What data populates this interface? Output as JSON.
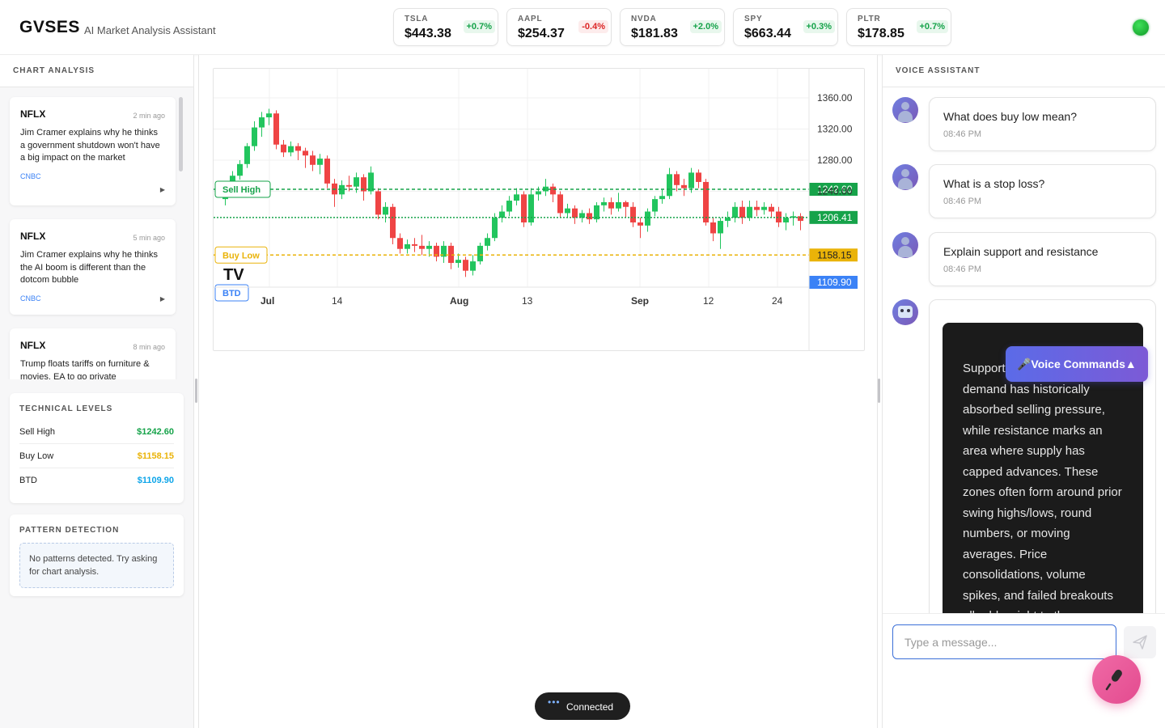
{
  "header": {
    "brand": "GVSES",
    "subtitle": "AI Market Analysis Assistant",
    "tickers": [
      {
        "symbol": "TSLA",
        "price": "$443.38",
        "change": "+0.7%",
        "direction": "up"
      },
      {
        "symbol": "AAPL",
        "price": "$254.37",
        "change": "-0.4%",
        "direction": "down"
      },
      {
        "symbol": "NVDA",
        "price": "$181.83",
        "change": "+2.0%",
        "direction": "up"
      },
      {
        "symbol": "SPY",
        "price": "$663.44",
        "change": "+0.3%",
        "direction": "up"
      },
      {
        "symbol": "PLTR",
        "price": "$178.85",
        "change": "+0.7%",
        "direction": "up"
      }
    ],
    "status_color": "#16a34a"
  },
  "left": {
    "title": "CHART ANALYSIS",
    "news": [
      {
        "symbol": "NFLX",
        "time": "2 min ago",
        "title": "Jim Cramer explains why he thinks a government shutdown won't have a big impact on the market",
        "source": "CNBC"
      },
      {
        "symbol": "NFLX",
        "time": "5 min ago",
        "title": "Jim Cramer explains why he thinks the AI boom is different than the dotcom bubble",
        "source": "CNBC"
      },
      {
        "symbol": "NFLX",
        "time": "8 min ago",
        "title": "Trump floats tariffs on furniture & movies. EA to go private",
        "source": ""
      }
    ],
    "technical_levels": {
      "title": "TECHNICAL LEVELS",
      "rows": [
        {
          "label": "Sell High",
          "value": "$1242.60",
          "color": "#16a34a"
        },
        {
          "label": "Buy Low",
          "value": "$1158.15",
          "color": "#eab308"
        },
        {
          "label": "BTD",
          "value": "$1109.90",
          "color": "#0ea5e9"
        }
      ]
    },
    "patterns": {
      "title": "PATTERN DETECTION",
      "empty_text": "No patterns detected. Try asking for chart analysis."
    }
  },
  "chart": {
    "price_labels": [
      "1360.00",
      "1320.00",
      "1280.00",
      "1240.00"
    ],
    "x_labels": [
      "Jul",
      "14",
      "Aug",
      "13",
      "Sep",
      "12",
      "24"
    ],
    "sell_high": {
      "label": "Sell High",
      "value": 1242.6,
      "tag": "1242.60",
      "color": "#16a34a"
    },
    "buy_low": {
      "label": "Buy Low",
      "value": 1158.15,
      "tag": "1158.15",
      "color": "#eab308"
    },
    "btd": {
      "label": "BTD",
      "value": 1109.9,
      "tag": "1109.90",
      "color": "#3b82f6"
    },
    "last_price": {
      "value": 1206.41,
      "tag": "1206.41",
      "color": "#16a34a"
    },
    "up_color": "#22c55e",
    "down_color": "#ef4444",
    "watermark": "TV"
  },
  "chart_data": {
    "type": "candlestick",
    "ylim": [
      1100,
      1380
    ],
    "candles": [
      [
        1230,
        1248,
        1252,
        1222
      ],
      [
        1248,
        1260,
        1266,
        1242
      ],
      [
        1260,
        1275,
        1280,
        1255
      ],
      [
        1275,
        1298,
        1302,
        1270
      ],
      [
        1298,
        1322,
        1330,
        1292
      ],
      [
        1322,
        1335,
        1342,
        1310
      ],
      [
        1335,
        1340,
        1346,
        1325
      ],
      [
        1340,
        1300,
        1344,
        1294
      ],
      [
        1300,
        1290,
        1306,
        1284
      ],
      [
        1290,
        1298,
        1304,
        1285
      ],
      [
        1298,
        1292,
        1302,
        1280
      ],
      [
        1292,
        1286,
        1296,
        1270
      ],
      [
        1286,
        1274,
        1292,
        1266
      ],
      [
        1274,
        1282,
        1288,
        1262
      ],
      [
        1282,
        1250,
        1286,
        1244
      ],
      [
        1250,
        1236,
        1256,
        1220
      ],
      [
        1236,
        1248,
        1254,
        1230
      ],
      [
        1248,
        1246,
        1260,
        1240
      ],
      [
        1246,
        1258,
        1264,
        1238
      ],
      [
        1258,
        1240,
        1262,
        1228
      ],
      [
        1240,
        1264,
        1272,
        1236
      ],
      [
        1240,
        1210,
        1244,
        1204
      ],
      [
        1210,
        1220,
        1226,
        1200
      ],
      [
        1220,
        1180,
        1224,
        1172
      ],
      [
        1180,
        1166,
        1186,
        1160
      ],
      [
        1166,
        1172,
        1178,
        1160
      ],
      [
        1172,
        1170,
        1180,
        1162
      ],
      [
        1170,
        1166,
        1184,
        1158
      ],
      [
        1166,
        1170,
        1176,
        1156
      ],
      [
        1170,
        1156,
        1174,
        1150
      ],
      [
        1156,
        1170,
        1176,
        1148
      ],
      [
        1170,
        1148,
        1174,
        1140
      ],
      [
        1148,
        1152,
        1160,
        1142
      ],
      [
        1152,
        1138,
        1156,
        1130
      ],
      [
        1138,
        1150,
        1158,
        1132
      ],
      [
        1150,
        1170,
        1174,
        1146
      ],
      [
        1170,
        1180,
        1186,
        1164
      ],
      [
        1180,
        1206,
        1212,
        1176
      ],
      [
        1206,
        1214,
        1222,
        1200
      ],
      [
        1214,
        1228,
        1234,
        1208
      ],
      [
        1228,
        1236,
        1244,
        1222
      ],
      [
        1236,
        1200,
        1240,
        1194
      ],
      [
        1200,
        1236,
        1244,
        1196
      ],
      [
        1236,
        1240,
        1246,
        1228
      ],
      [
        1240,
        1246,
        1256,
        1234
      ],
      [
        1246,
        1236,
        1250,
        1226
      ],
      [
        1236,
        1212,
        1240,
        1206
      ],
      [
        1212,
        1218,
        1224,
        1206
      ],
      [
        1218,
        1206,
        1222,
        1198
      ],
      [
        1206,
        1212,
        1216,
        1200
      ],
      [
        1212,
        1204,
        1218,
        1198
      ],
      [
        1204,
        1222,
        1226,
        1200
      ],
      [
        1222,
        1226,
        1232,
        1214
      ],
      [
        1226,
        1218,
        1232,
        1210
      ],
      [
        1218,
        1226,
        1238,
        1214
      ],
      [
        1226,
        1220,
        1228,
        1206
      ],
      [
        1220,
        1200,
        1226,
        1194
      ],
      [
        1200,
        1196,
        1206,
        1180
      ],
      [
        1196,
        1214,
        1218,
        1188
      ],
      [
        1214,
        1230,
        1234,
        1208
      ],
      [
        1230,
        1234,
        1242,
        1224
      ],
      [
        1234,
        1262,
        1270,
        1230
      ],
      [
        1262,
        1248,
        1266,
        1240
      ],
      [
        1248,
        1244,
        1256,
        1234
      ],
      [
        1244,
        1264,
        1270,
        1238
      ],
      [
        1264,
        1252,
        1268,
        1244
      ],
      [
        1252,
        1200,
        1256,
        1196
      ],
      [
        1200,
        1186,
        1206,
        1176
      ],
      [
        1186,
        1202,
        1206,
        1166
      ],
      [
        1202,
        1206,
        1214,
        1194
      ],
      [
        1206,
        1220,
        1226,
        1200
      ],
      [
        1220,
        1206,
        1228,
        1198
      ],
      [
        1206,
        1220,
        1228,
        1202
      ],
      [
        1220,
        1216,
        1228,
        1208
      ],
      [
        1216,
        1220,
        1226,
        1210
      ],
      [
        1220,
        1214,
        1224,
        1206
      ],
      [
        1214,
        1200,
        1220,
        1194
      ],
      [
        1200,
        1206,
        1212,
        1190
      ],
      [
        1206,
        1208,
        1214,
        1196
      ],
      [
        1208,
        1202,
        1212,
        1190
      ]
    ]
  },
  "right": {
    "title": "VOICE ASSISTANT",
    "messages": [
      {
        "text": "What does buy low mean?",
        "time": "08:46 PM"
      },
      {
        "text": "What is a stop loss?",
        "time": "08:46 PM"
      },
      {
        "text": "Explain support and resistance",
        "time": "08:46 PM"
      }
    ],
    "bot_response": "Support marks a zone where demand has historically absorbed selling pressure, while resistance marks an area where supply has capped advances. These zones often form around prior swing highs/lows, round numbers, or moving averages. Price consolidations, volume spikes, and failed breakouts all add weight to these zones.",
    "voice_commands_label": "🎤Voice Commands▲",
    "input_placeholder": "Type a message..."
  },
  "status": {
    "dots": "•••",
    "label": "Connected"
  }
}
